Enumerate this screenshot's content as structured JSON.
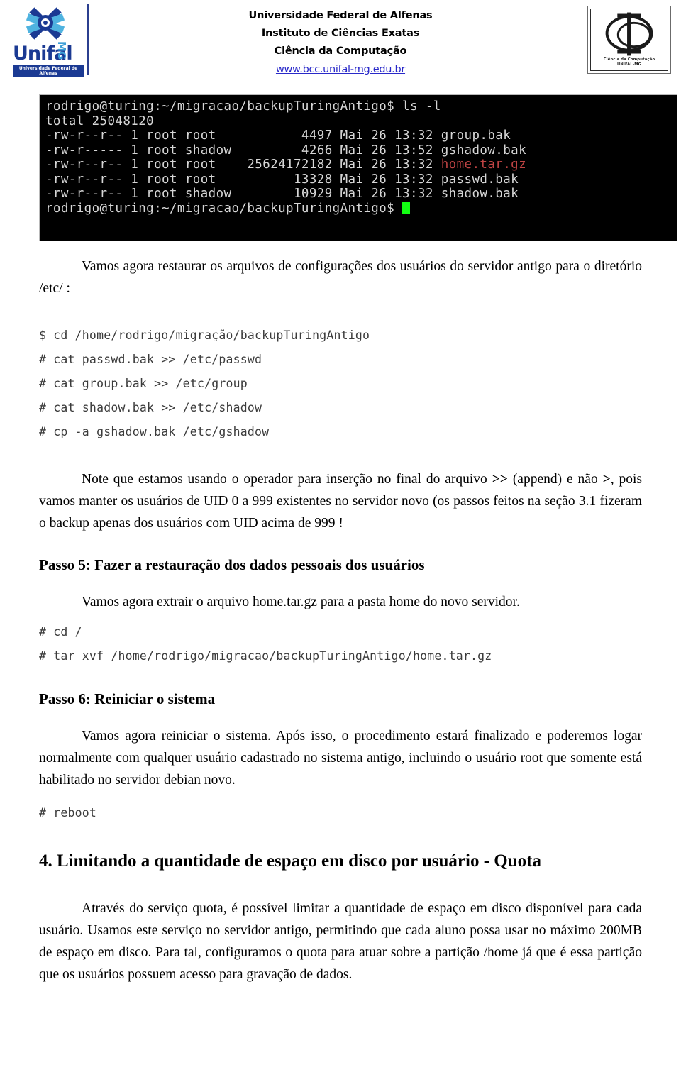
{
  "header": {
    "institution_line1": "Universidade Federal de Alfenas",
    "institution_line2": "Instituto de Ciências Exatas",
    "institution_line3": "Ciência da Computação",
    "url": "www.bcc.unifal-mg.edu.br",
    "left_logo": {
      "wordmark": "Unifal",
      "suffix": "MG",
      "subtitle": "Universidade Federal de Alfenas"
    },
    "right_logo": {
      "caption_line1": "Ciência da Computação",
      "caption_line2": "UNIFAL-MG"
    },
    "link_color": "#2929c9"
  },
  "terminal": {
    "background": "#000000",
    "text_color": "#d6d6d6",
    "highlight_color": "#c04444",
    "cursor_color": "#12ff12",
    "lines": [
      "rodrigo@turing:~/migracao/backupTuringAntigo$ ls -l",
      "total 25048120",
      "-rw-r--r-- 1 root root           4497 Mai 26 13:32 group.bak",
      "-rw-r----- 1 root shadow         4266 Mai 26 13:52 gshadow.bak",
      "-rw-r--r-- 1 root root    25624172182 Mai 26 13:32 ",
      "-rw-r--r-- 1 root root          13328 Mai 26 13:32 passwd.bak",
      "-rw-r--r-- 1 root shadow        10929 Mai 26 13:32 shadow.bak",
      "rodrigo@turing:~/migracao/backupTuringAntigo$ "
    ],
    "highlight_filename": "home.tar.gz"
  },
  "content": {
    "para_restore": "Vamos agora restaurar os arquivos de configurações dos usuários do servidor antigo para o diretório /etc/ :",
    "code_block_1": [
      "$ cd /home/rodrigo/migração/backupTuringAntigo",
      "# cat passwd.bak >> /etc/passwd",
      "# cat group.bak >> /etc/group",
      "# cat shadow.bak >> /etc/shadow",
      "# cp -a gshadow.bak /etc/gshadow"
    ],
    "note_part1": "Note que estamos usando o operador para inserção no final do arquivo ",
    "note_op_append": ">>",
    "note_part2": " (append) e não ",
    "note_op_single": ">",
    "note_part3": ", pois vamos manter os usuários de UID 0 a 999 existentes no servidor novo (os passos feitos na seção 3.1 fizeram o backup apenas dos usuários com UID acima de 999 !",
    "step5_title": "Passo 5: Fazer a restauração dos dados pessoais dos usuários",
    "step5_para": "Vamos agora extrair o arquivo home.tar.gz para a pasta home do novo servidor.",
    "code_block_2": [
      "# cd /",
      "# tar xvf /home/rodrigo/migracao/backupTuringAntigo/home.tar.gz"
    ],
    "step6_title": "Passo 6: Reiniciar o sistema",
    "step6_para": "Vamos agora reiniciar o sistema. Após isso, o procedimento estará finalizado e poderemos logar normalmente com qualquer usuário cadastrado no sistema antigo, incluindo o usuário root que somente está habilitado no servidor debian novo.",
    "code_block_3": [
      "# reboot"
    ],
    "section4_title": "4. Limitando a quantidade de espaço em disco por usuário - Quota",
    "section4_para": "Através do serviço quota, é possível limitar a quantidade de espaço em disco disponível para cada usuário. Usamos este serviço no servidor antigo, permitindo que cada aluno possa usar no máximo 200MB de espaço em disco. Para tal, configuramos o quota para atuar sobre a partição /home já que é essa partição que os usuários possuem acesso para gravação de dados."
  }
}
